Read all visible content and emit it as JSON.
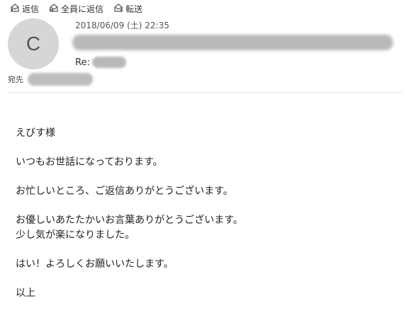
{
  "toolbar": {
    "reply_label": "返信",
    "reply_all_label": "全員に返信",
    "forward_label": "転送"
  },
  "message": {
    "avatar_initial": "C",
    "date": "2018/06/09 (土) 22:35",
    "subject_prefix": "Re:",
    "to_label": "宛先"
  },
  "body": {
    "line1": "えびす様",
    "line2": "いつもお世話になっております。",
    "line3": "お忙しいところ、ご返信ありがとうございます。",
    "line4": "お優しいあたたかいお言葉ありがとうございます。",
    "line5": "少し気が楽になりました。",
    "line6": "はい！よろしくお願いいたします。",
    "line7": "以上"
  }
}
